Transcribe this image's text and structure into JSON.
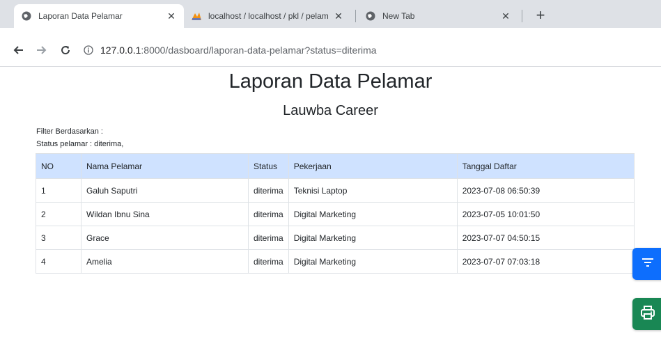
{
  "browser": {
    "tabs": [
      {
        "title": "Laporan Data Pelamar",
        "active": true,
        "favicon": "globe-icon"
      },
      {
        "title": "localhost / localhost / pkl / pelam",
        "active": false,
        "favicon": "phpmyadmin-icon"
      },
      {
        "title": "New Tab",
        "active": false,
        "favicon": "globe-icon"
      }
    ],
    "url_host": "127.0.0.1",
    "url_rest": ":8000/dasboard/laporan-data-pelamar?status=diterima"
  },
  "page": {
    "title": "Laporan Data Pelamar",
    "subtitle": "Lauwba Career",
    "filter_label": "Filter Berdasarkan :",
    "filter_status": "Status pelamar : diterima,"
  },
  "table": {
    "headers": [
      "NO",
      "Nama Pelamar",
      "Status",
      "Pekerjaan",
      "Tanggal Daftar"
    ],
    "rows": [
      [
        "1",
        "Galuh Saputri",
        "diterima",
        "Teknisi Laptop",
        "2023-07-08 06:50:39"
      ],
      [
        "2",
        "Wildan Ibnu Sina",
        "diterima",
        "Digital Marketing",
        "2023-07-05 10:01:50"
      ],
      [
        "3",
        "Grace",
        "diterima",
        "Digital Marketing",
        "2023-07-07 04:50:15"
      ],
      [
        "4",
        "Amelia",
        "diterima",
        "Digital Marketing",
        "2023-07-07 07:03:18"
      ]
    ]
  },
  "colors": {
    "table_header_bg": "#cfe2ff",
    "filter_button": "#0d6efd",
    "print_button": "#198754"
  },
  "icons": {
    "filter_button": "filter-icon",
    "print_button": "printer-icon"
  }
}
